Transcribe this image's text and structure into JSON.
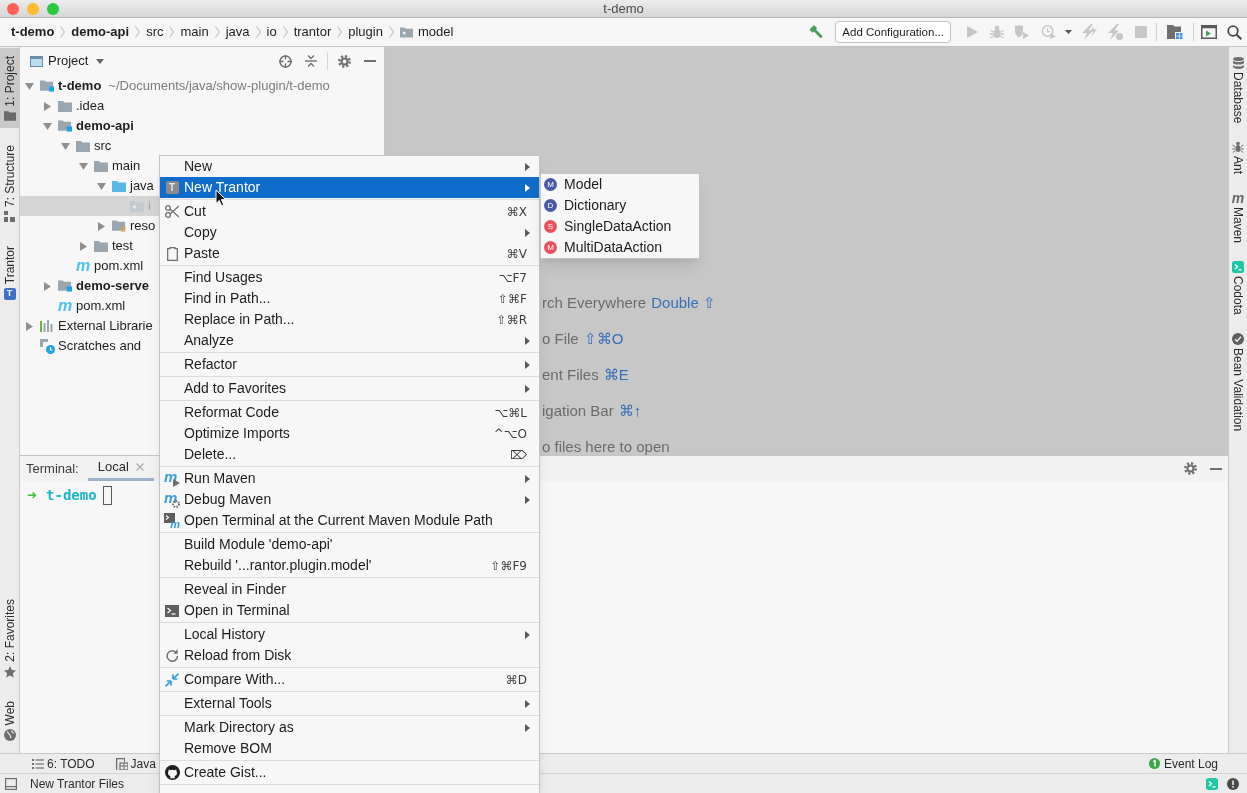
{
  "window": {
    "title": "t-demo"
  },
  "breadcrumbs": [
    {
      "label": "t-demo",
      "kind": "module"
    },
    {
      "label": "demo-api",
      "kind": "module"
    },
    {
      "label": "src",
      "kind": "folder"
    },
    {
      "label": "main",
      "kind": "folder"
    },
    {
      "label": "java",
      "kind": "folder"
    },
    {
      "label": "io",
      "kind": "folder"
    },
    {
      "label": "trantor",
      "kind": "folder"
    },
    {
      "label": "plugin",
      "kind": "folder"
    },
    {
      "label": "model",
      "kind": "package"
    }
  ],
  "toolbar": {
    "configuration": "Add Configuration...",
    "run_disabled": true
  },
  "left_tool_windows": [
    {
      "label": "1: Project",
      "kind": "project",
      "selected": true
    },
    {
      "label": "7: Structure",
      "kind": "structure",
      "selected": false
    },
    {
      "label": "Trantor",
      "kind": "trantor",
      "icon_text": "T",
      "selected": false
    }
  ],
  "left_tool_windows_bottom": [
    {
      "label": "2: Favorites",
      "kind": "favorites",
      "selected": false
    },
    {
      "label": "Web",
      "kind": "web",
      "selected": false
    }
  ],
  "right_tool_windows": [
    {
      "label": "Database",
      "kind": "database"
    },
    {
      "label": "Ant",
      "kind": "ant"
    },
    {
      "label": "Maven",
      "kind": "maven",
      "icon_text": "m"
    },
    {
      "label": "Codota",
      "kind": "codota"
    },
    {
      "label": "Bean Validation",
      "kind": "bean"
    }
  ],
  "project_panel": {
    "title": "Project",
    "tree": [
      {
        "label": "t-demo",
        "location": "~/Documents/java/show-plugin/t-demo",
        "kind": "module",
        "expanded": true,
        "selected": false,
        "children": [
          {
            "label": ".idea",
            "kind": "folder",
            "expanded": false,
            "selected": false
          },
          {
            "label": "demo-api",
            "kind": "module",
            "expanded": true,
            "selected": false,
            "children": [
              {
                "label": "src",
                "kind": "folder",
                "expanded": true,
                "selected": false,
                "children": [
                  {
                    "label": "main",
                    "kind": "folder",
                    "expanded": true,
                    "selected": false,
                    "children": [
                      {
                        "label": "java",
                        "kind": "source",
                        "expanded": true,
                        "selected": false,
                        "children": [
                          {
                            "label": "i",
                            "kind": "package",
                            "selected": true
                          }
                        ]
                      },
                      {
                        "label": "reso",
                        "kind": "resources",
                        "expanded": false,
                        "selected": false
                      }
                    ]
                  },
                  {
                    "label": "test",
                    "kind": "folder",
                    "expanded": false,
                    "selected": false
                  }
                ]
              },
              {
                "label": "pom.xml",
                "kind": "maven",
                "icon_text": "m",
                "selected": false
              }
            ]
          },
          {
            "label": "demo-serve",
            "kind": "module",
            "expanded": false,
            "selected": false
          },
          {
            "label": "pom.xml",
            "kind": "maven",
            "icon_text": "m",
            "selected": false
          }
        ]
      },
      {
        "label": "External Librarie",
        "kind": "libraries",
        "expanded": false,
        "selected": false
      },
      {
        "label": "Scratches and",
        "kind": "scratches",
        "selected": false
      }
    ]
  },
  "editor": {
    "hints": [
      {
        "text": "rch Everywhere",
        "shortcut": "Double ⇧"
      },
      {
        "text": "o File",
        "shortcut": "⇧⌘O"
      },
      {
        "text": "ent Files",
        "shortcut": "⌘E"
      },
      {
        "text": "igation Bar",
        "shortcut": "⌘↑"
      },
      {
        "text": "o files here to open"
      }
    ]
  },
  "terminal": {
    "title": "Terminal:",
    "tabs": [
      {
        "label": "Local",
        "selected": true
      }
    ],
    "prompt_arrow": "➜",
    "prompt": "t-demo"
  },
  "bottom_tools": [
    {
      "label": "6: TODO",
      "kind": "todo"
    },
    {
      "label": "Java",
      "kind": "java"
    }
  ],
  "bottom_tools_right": [
    {
      "label": "Event Log",
      "kind": "event-log"
    }
  ],
  "status_bar": {
    "message": "New Trantor Files"
  },
  "context_menu": {
    "groups": [
      [
        {
          "label": "New",
          "submenu": true,
          "selected": false
        },
        {
          "label": "New Trantor",
          "kind": "trantor",
          "icon_text": "T",
          "submenu": true,
          "selected": true
        }
      ],
      [
        {
          "label": "Cut",
          "kind": "cut",
          "shortcut": "⌘X",
          "submenu": false,
          "selected": false
        },
        {
          "label": "Copy",
          "submenu": true,
          "selected": false
        },
        {
          "label": "Paste",
          "kind": "paste",
          "shortcut": "⌘V",
          "submenu": false,
          "selected": false
        }
      ],
      [
        {
          "label": "Find Usages",
          "shortcut": "⌥F7",
          "submenu": false,
          "selected": false
        },
        {
          "label": "Find in Path...",
          "shortcut": "⇧⌘F",
          "submenu": false,
          "selected": false
        },
        {
          "label": "Replace in Path...",
          "shortcut": "⇧⌘R",
          "submenu": false,
          "selected": false
        },
        {
          "label": "Analyze",
          "submenu": true,
          "selected": false
        }
      ],
      [
        {
          "label": "Refactor",
          "submenu": true,
          "selected": false
        }
      ],
      [
        {
          "label": "Add to Favorites",
          "submenu": true,
          "selected": false
        }
      ],
      [
        {
          "label": "Reformat Code",
          "shortcut": "⌥⌘L",
          "submenu": false,
          "selected": false
        },
        {
          "label": "Optimize Imports",
          "shortcut": "^⌥O",
          "submenu": false,
          "selected": false
        },
        {
          "label": "Delete...",
          "shortcut": "⌦",
          "submenu": false,
          "selected": false
        }
      ],
      [
        {
          "label": "Run Maven",
          "kind": "maven-run",
          "icon_text": "m",
          "submenu": true,
          "selected": false
        },
        {
          "label": "Debug Maven",
          "kind": "maven-debug",
          "icon_text": "m",
          "submenu": true,
          "selected": false
        },
        {
          "label": "Open Terminal at the Current Maven Module Path",
          "kind": "maven-terminal",
          "icon_text": "m",
          "submenu": false,
          "selected": false
        }
      ],
      [
        {
          "label": "Build Module 'demo-api'",
          "submenu": false,
          "selected": false
        },
        {
          "label": "Rebuild '...rantor.plugin.model'",
          "shortcut": "⇧⌘F9",
          "submenu": false,
          "selected": false
        }
      ],
      [
        {
          "label": "Reveal in Finder",
          "submenu": false,
          "selected": false
        },
        {
          "label": "Open in Terminal",
          "kind": "terminal",
          "submenu": false,
          "selected": false
        }
      ],
      [
        {
          "label": "Local History",
          "submenu": true,
          "selected": false
        },
        {
          "label": "Reload from Disk",
          "kind": "reload",
          "submenu": false,
          "selected": false
        }
      ],
      [
        {
          "label": "Compare With...",
          "kind": "compare",
          "shortcut": "⌘D",
          "submenu": false,
          "selected": false
        }
      ],
      [
        {
          "label": "External Tools",
          "submenu": true,
          "selected": false
        }
      ],
      [
        {
          "label": "Mark Directory as",
          "submenu": true,
          "selected": false
        },
        {
          "label": "Remove BOM",
          "submenu": false,
          "selected": false
        }
      ],
      [
        {
          "label": "Create Gist...",
          "kind": "gist",
          "submenu": false,
          "selected": false
        }
      ]
    ],
    "submenu": [
      {
        "label": "Model",
        "badge": "M",
        "color": "#4a5aa8",
        "selected": false
      },
      {
        "label": "Dictionary",
        "badge": "D",
        "color": "#4a5aa8",
        "selected": false
      },
      {
        "label": "SingleDataAction",
        "badge": "S",
        "color": "#ea4f5d",
        "selected": false
      },
      {
        "label": "MultiDataAction",
        "badge": "M",
        "color": "#ea4f5d",
        "selected": false
      }
    ]
  }
}
